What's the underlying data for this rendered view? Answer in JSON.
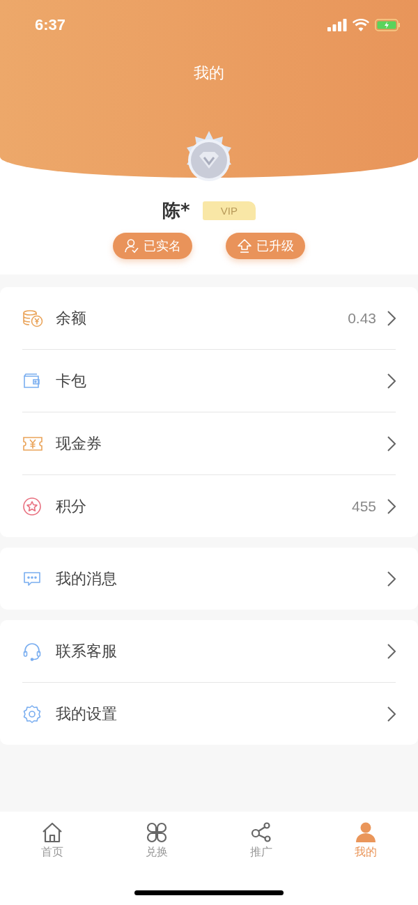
{
  "status_bar": {
    "time": "6:37"
  },
  "header": {
    "title": "我的"
  },
  "profile": {
    "name": "陈*",
    "badge": "VIP",
    "tags": [
      {
        "kind": "verified",
        "label": "已实名"
      },
      {
        "kind": "upgraded",
        "label": "已升级"
      }
    ]
  },
  "groups": [
    {
      "items": [
        {
          "kind": "coins",
          "label": "余额",
          "value": "0.43"
        },
        {
          "kind": "wallet",
          "label": "卡包"
        },
        {
          "kind": "ticket",
          "label": "现金券"
        },
        {
          "kind": "star",
          "label": "积分",
          "value": "455"
        }
      ]
    },
    {
      "items": [
        {
          "kind": "message",
          "label": "我的消息"
        }
      ]
    },
    {
      "items": [
        {
          "kind": "headset",
          "label": "联系客服"
        },
        {
          "kind": "gear",
          "label": "我的设置"
        }
      ]
    }
  ],
  "tabs": [
    {
      "kind": "home",
      "label": "首页",
      "selected": false
    },
    {
      "kind": "clover",
      "label": "兑换",
      "selected": false
    },
    {
      "kind": "share",
      "label": "推广",
      "selected": false
    },
    {
      "kind": "person",
      "label": "我的",
      "selected": true
    }
  ]
}
